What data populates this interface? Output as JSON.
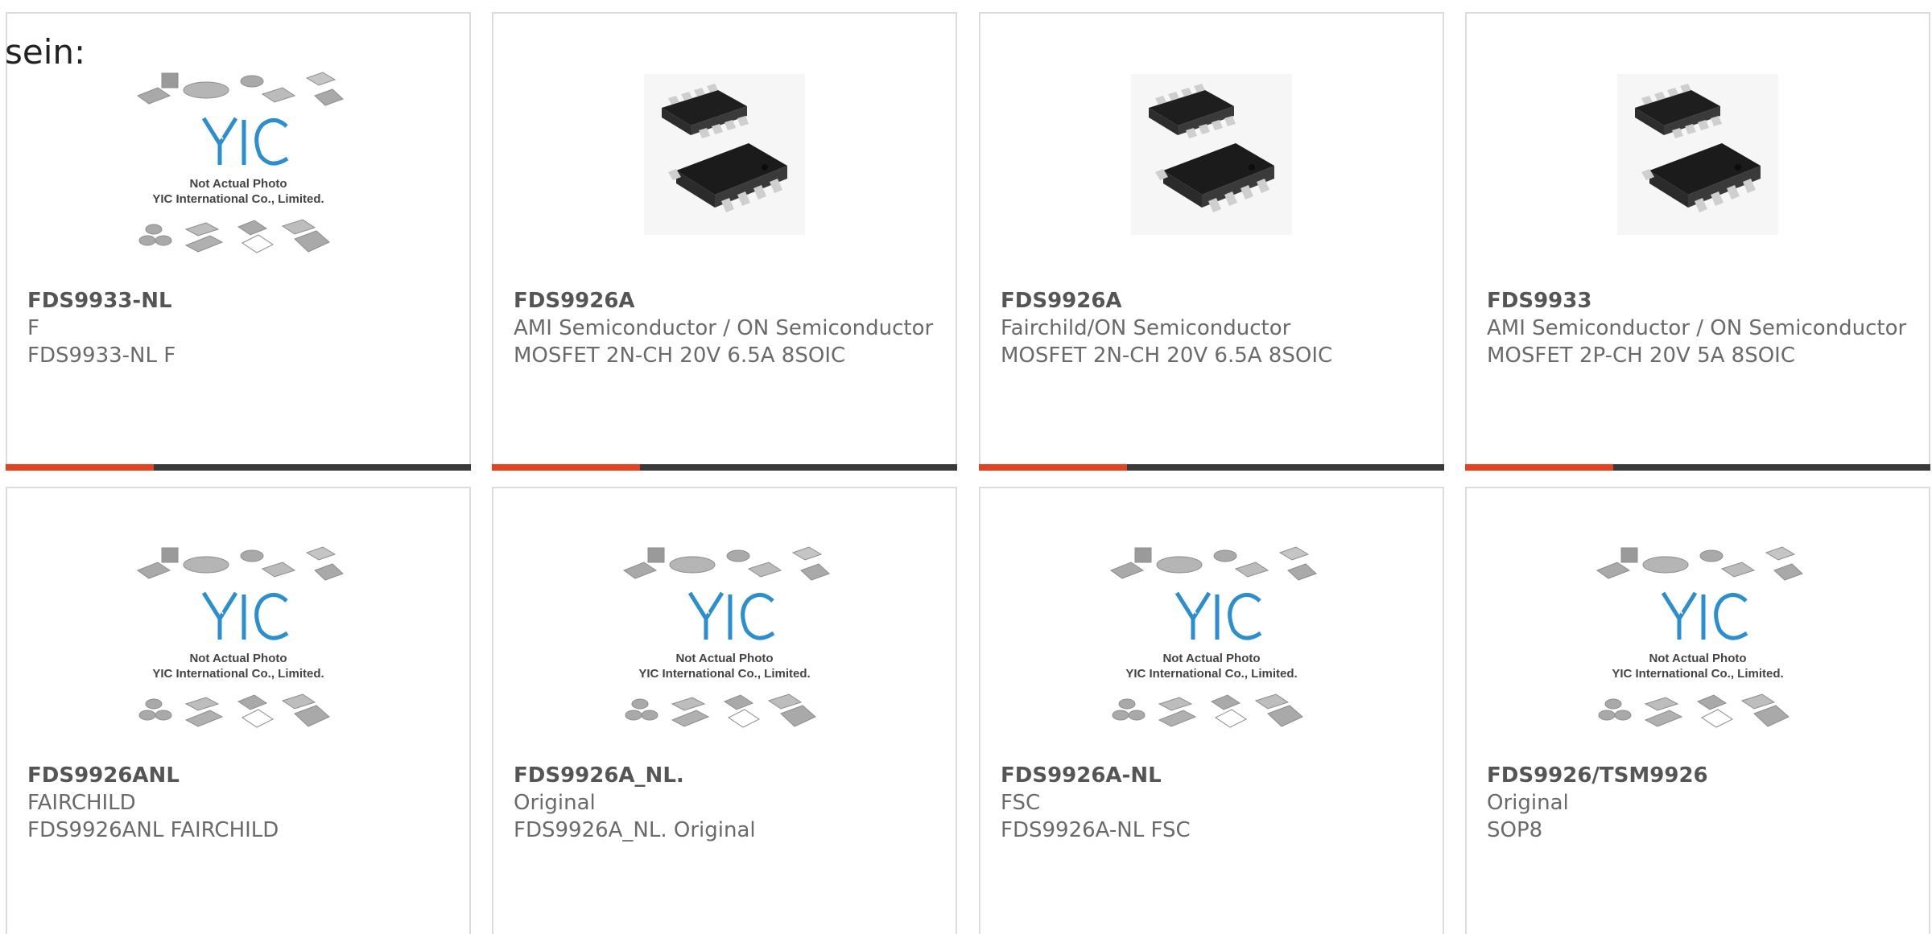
{
  "heading_fragment": "sein:",
  "products": [
    {
      "part": "FDS9933-NL",
      "manufacturer": "F",
      "description": "FDS9933-NL F",
      "image": "placeholder-photo"
    },
    {
      "part": "FDS9926A",
      "manufacturer": "AMI Semiconductor / ON Semiconductor",
      "description": "MOSFET 2N-CH 20V 6.5A 8SOIC",
      "image": "soic8-chip-photo"
    },
    {
      "part": "FDS9926A",
      "manufacturer": "Fairchild/ON Semiconductor",
      "description": "MOSFET 2N-CH 20V 6.5A 8SOIC",
      "image": "soic8-chip-photo"
    },
    {
      "part": "FDS9933",
      "manufacturer": "AMI Semiconductor / ON Semiconductor",
      "description": "MOSFET 2P-CH 20V 5A 8SOIC",
      "image": "soic8-chip-photo"
    },
    {
      "part": "FDS9926ANL",
      "manufacturer": "FAIRCHILD",
      "description": "FDS9926ANL FAIRCHILD",
      "image": "placeholder-photo"
    },
    {
      "part": "FDS9926A_NL.",
      "manufacturer": "Original",
      "description": "FDS9926A_NL. Original",
      "image": "placeholder-photo"
    },
    {
      "part": "FDS9926A-NL",
      "manufacturer": "FSC",
      "description": "FDS9926A-NL FSC",
      "image": "placeholder-photo"
    },
    {
      "part": "FDS9926/TSM9926",
      "manufacturer": "Original",
      "description": "SOP8",
      "image": "placeholder-photo"
    }
  ],
  "placeholder": {
    "logo_text": "YIC",
    "line1": "Not Actual Photo",
    "line2": "YIC International Co., Limited."
  },
  "colors": {
    "accent": "#e8411d",
    "bar": "#3a3a3a",
    "logo": "#2a8fd0"
  }
}
